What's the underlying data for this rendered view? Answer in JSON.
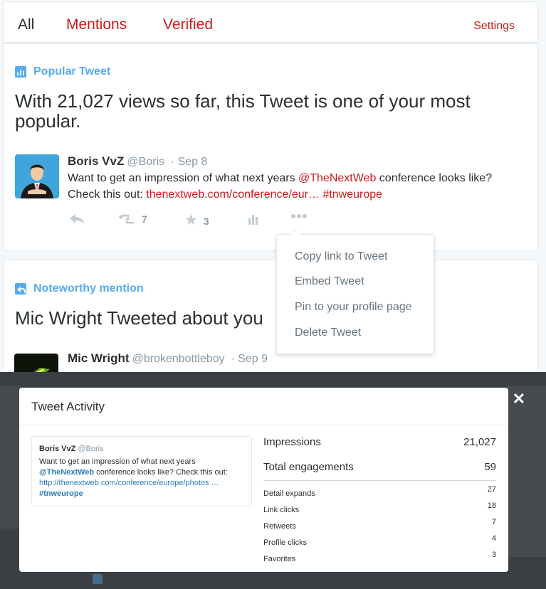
{
  "tabs": {
    "all": "All",
    "mentions": "Mentions",
    "verified": "Verified",
    "settings": "Settings"
  },
  "popular": {
    "kind": "Popular Tweet",
    "headline": "With 21,027 views so far, this Tweet is one of your most popular.",
    "name": "Boris VvZ",
    "handle": "@Boris",
    "date": "· Sep 8",
    "text_a": "Want to get an impression of what next years ",
    "mention": "@TheNextWeb",
    "text_b": " conference looks like? Check this out: ",
    "link": "thenextweb.com/conference/eur…",
    "hashtag": "#tnweurope",
    "retweets": "7",
    "favorites": "3"
  },
  "menu": {
    "items": [
      "Copy link to Tweet",
      "Embed Tweet",
      "Pin to your profile page",
      "Delete Tweet"
    ]
  },
  "mention": {
    "kind": "Noteworthy mention",
    "headline": "Mic Wright Tweeted about you",
    "name": "Mic Wright",
    "handle": "@brokenbottleboy",
    "date": "· Sep 9"
  },
  "modal": {
    "title": "Tweet Activity",
    "close": "✕",
    "embed": {
      "name": "Boris VvZ",
      "handle": "@Boris",
      "text_a": "Want to get an impression of what next years",
      "mention": "@TheNextWeb",
      "text_b": " conference looks like? Check this out:",
      "link": "http://thenextweb.com/conference/europe/photos …",
      "hashtag": "#tnweurope"
    },
    "impressions_label": "Impressions",
    "impressions": "21,027",
    "engagements_label": "Total engagements",
    "engagements": "59",
    "breakdown": [
      {
        "label": "Detail expands",
        "value": "27"
      },
      {
        "label": "Link clicks",
        "value": "18"
      },
      {
        "label": "Retweets",
        "value": "7"
      },
      {
        "label": "Profile clicks",
        "value": "4"
      },
      {
        "label": "Favorites",
        "value": "3"
      }
    ]
  },
  "colors": {
    "accent_red": "#cc1a1a",
    "twitter_blue": "#55acee",
    "overlay": "#3a3f44"
  }
}
